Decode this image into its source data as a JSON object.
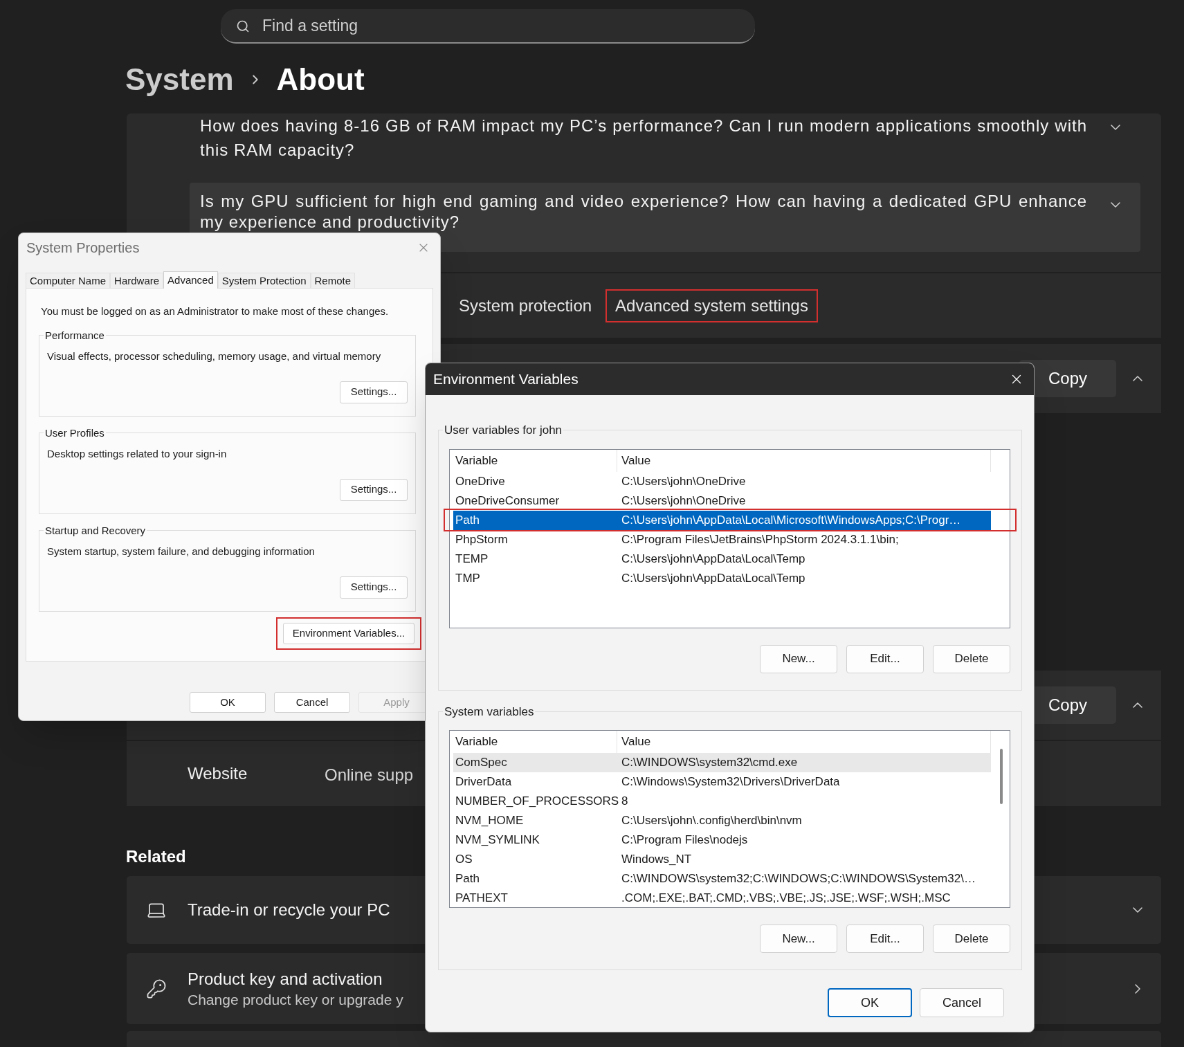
{
  "search": {
    "placeholder": "Find a setting"
  },
  "breadcrumb": [
    "System",
    "About"
  ],
  "faq": [
    {
      "question": "How does having 8-16 GB of RAM impact my PC’s performance? Can I run modern applications smoothly with this RAM capacity?",
      "expanded": false,
      "selected": false
    },
    {
      "question": "Is my GPU sufficient for high end gaming and video experience? How can having a dedicated GPU enhance my experience and productivity?",
      "expanded": false,
      "selected": true
    }
  ],
  "links": [
    {
      "label": "System protection",
      "highlighted": false
    },
    {
      "label": "Advanced system settings",
      "highlighted": true
    }
  ],
  "spec_sections": [
    {
      "button": "Copy",
      "expanded": true
    },
    {
      "button": "Copy",
      "expanded": true
    }
  ],
  "support_links": [
    "Website",
    "Online supp"
  ],
  "related": {
    "title": "Related",
    "items": [
      {
        "kind": "expander",
        "title": "Trade-in or recycle your PC"
      },
      {
        "kind": "link",
        "title": "Product key and activation",
        "subtitle": "Change product key or upgrade y"
      }
    ]
  },
  "system_properties": {
    "title": "System Properties",
    "tabs": [
      {
        "label": "Computer Name",
        "selected": false
      },
      {
        "label": "Hardware",
        "selected": false
      },
      {
        "label": "Advanced",
        "selected": true
      },
      {
        "label": "System Protection",
        "selected": false
      },
      {
        "label": "Remote",
        "selected": false
      }
    ],
    "notice": "You must be logged on as an Administrator to make most of these changes.",
    "groups": [
      {
        "title": "Performance",
        "description": "Visual effects, processor scheduling, memory usage, and virtual memory",
        "button": "Settings..."
      },
      {
        "title": "User Profiles",
        "description": "Desktop settings related to your sign-in",
        "button": "Settings..."
      },
      {
        "title": "Startup and Recovery",
        "description": "System startup, system failure, and debugging information",
        "button": "Settings..."
      }
    ],
    "env_button": {
      "label": "Environment Variables...",
      "highlighted": true
    },
    "buttons": [
      {
        "label": "OK",
        "disabled": false
      },
      {
        "label": "Cancel",
        "disabled": false
      },
      {
        "label": "Apply",
        "disabled": true
      }
    ]
  },
  "environment_variables": {
    "title": "Environment Variables",
    "user": {
      "title": "User variables for john",
      "columns": [
        "Variable",
        "Value"
      ],
      "focused": true,
      "rows": [
        {
          "name": "OneDrive",
          "value": "C:\\Users\\john\\OneDrive",
          "selected": false,
          "highlighted": false
        },
        {
          "name": "OneDriveConsumer",
          "value": "C:\\Users\\john\\OneDrive",
          "selected": false,
          "highlighted": false
        },
        {
          "name": "Path",
          "value": "C:\\Users\\john\\AppData\\Local\\Microsoft\\WindowsApps;C:\\Progr…",
          "selected": true,
          "highlighted": true
        },
        {
          "name": "PhpStorm",
          "value": "C:\\Program Files\\JetBrains\\PhpStorm 2024.3.1.1\\bin;",
          "selected": false,
          "highlighted": false
        },
        {
          "name": "TEMP",
          "value": "C:\\Users\\john\\AppData\\Local\\Temp",
          "selected": false,
          "highlighted": false
        },
        {
          "name": "TMP",
          "value": "C:\\Users\\john\\AppData\\Local\\Temp",
          "selected": false,
          "highlighted": false
        }
      ],
      "buttons": [
        "New...",
        "Edit...",
        "Delete"
      ]
    },
    "system": {
      "title": "System variables",
      "columns": [
        "Variable",
        "Value"
      ],
      "focused": false,
      "rows": [
        {
          "name": "ComSpec",
          "value": "C:\\WINDOWS\\system32\\cmd.exe",
          "selected": true,
          "highlighted": false
        },
        {
          "name": "DriverData",
          "value": "C:\\Windows\\System32\\Drivers\\DriverData",
          "selected": false,
          "highlighted": false
        },
        {
          "name": "NUMBER_OF_PROCESSORS",
          "value": "8",
          "selected": false,
          "highlighted": false
        },
        {
          "name": "NVM_HOME",
          "value": "C:\\Users\\john\\.config\\herd\\bin\\nvm",
          "selected": false,
          "highlighted": false
        },
        {
          "name": "NVM_SYMLINK",
          "value": "C:\\Program Files\\nodejs",
          "selected": false,
          "highlighted": false
        },
        {
          "name": "OS",
          "value": "Windows_NT",
          "selected": false,
          "highlighted": false
        },
        {
          "name": "Path",
          "value": "C:\\WINDOWS\\system32;C:\\WINDOWS;C:\\WINDOWS\\System32\\…",
          "selected": false,
          "highlighted": false
        },
        {
          "name": "PATHEXT",
          "value": ".COM;.EXE;.BAT;.CMD;.VBS;.VBE;.JS;.JSE;.WSF;.WSH;.MSC",
          "selected": false,
          "highlighted": false
        }
      ],
      "buttons": [
        "New...",
        "Edit...",
        "Delete"
      ]
    },
    "buttons": [
      {
        "label": "OK",
        "default": true
      },
      {
        "label": "Cancel",
        "default": false
      }
    ]
  }
}
